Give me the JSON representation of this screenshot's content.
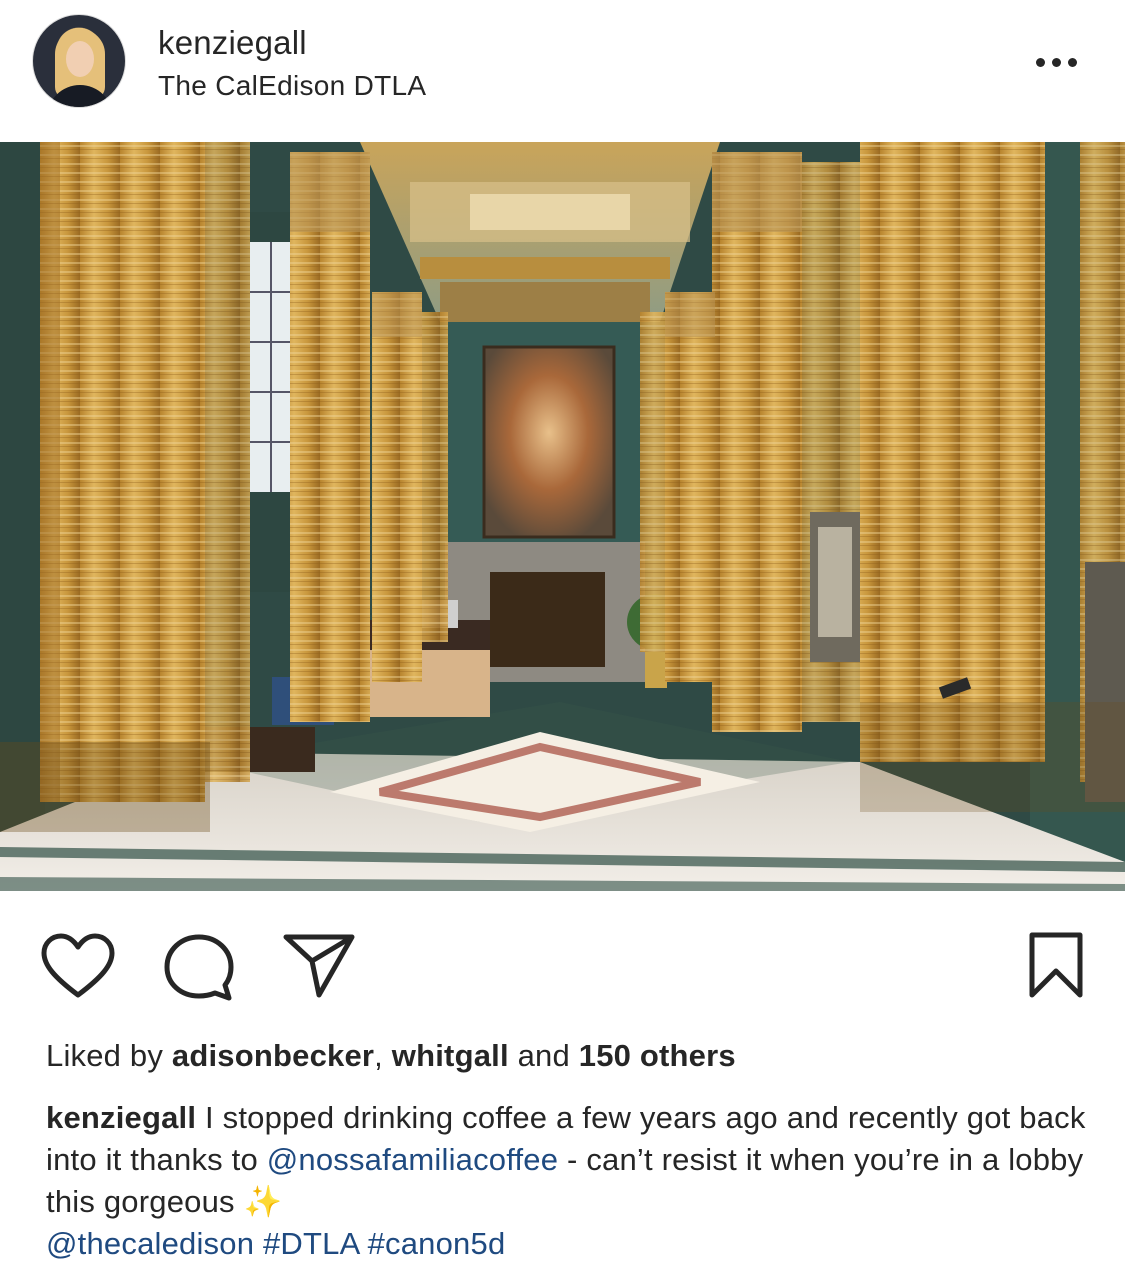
{
  "post": {
    "username": "kenziegall",
    "location": "The CalEdison DTLA",
    "liked_by_prefix": "Liked by ",
    "liked_user_1": "adisonbecker",
    "liked_sep": ", ",
    "liked_user_2": "whitgall",
    "liked_and": " and ",
    "liked_others": "150 others",
    "caption_user": "kenziegall",
    "caption_text_1": " I stopped drinking coffee a few years ago and recently got back into it thanks to ",
    "caption_mention_1": "@nossafamiliacoffee",
    "caption_text_2": " - can’t resist it when you’re in a lobby this gorgeous ",
    "caption_emoji": "✨",
    "caption_mention_2": "@thecaledison",
    "caption_tag_1": "#DTLA",
    "caption_tag_2": "#canon5d"
  },
  "icons": {
    "more": "more-options-icon",
    "like": "heart-icon",
    "comment": "comment-icon",
    "share": "paper-plane-icon",
    "save": "bookmark-icon"
  },
  "colors": {
    "link": "#1f4a80",
    "text": "#262626"
  }
}
